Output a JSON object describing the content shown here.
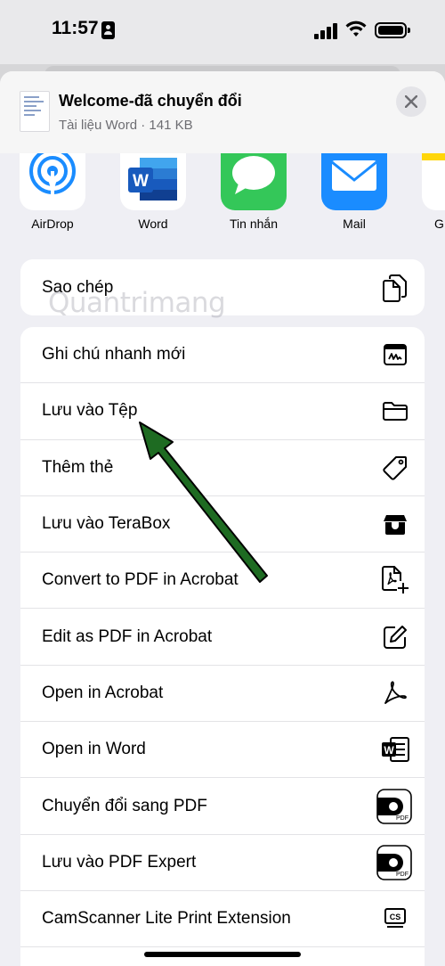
{
  "status": {
    "time": "11:57"
  },
  "header": {
    "title": "Welcome-đã chuyển đổi",
    "subtitle": "Tài liệu Word · 141 KB"
  },
  "apps": [
    {
      "label": "AirDrop",
      "icon": "airdrop-icon"
    },
    {
      "label": "Word",
      "icon": "word-icon"
    },
    {
      "label": "Tin nhắn",
      "icon": "messages-icon"
    },
    {
      "label": "Mail",
      "icon": "mail-icon"
    },
    {
      "label": "G",
      "icon": "notes-icon"
    }
  ],
  "copy_action": {
    "label": "Sao chép",
    "icon": "copy-icon"
  },
  "actions": [
    {
      "label": "Ghi chú nhanh mới",
      "icon": "quick-note-icon"
    },
    {
      "label": "Lưu vào Tệp",
      "icon": "folder-icon"
    },
    {
      "label": "Thêm thẻ",
      "icon": "tag-icon"
    },
    {
      "label": "Lưu vào TeraBox",
      "icon": "terabox-icon"
    },
    {
      "label": "Convert to PDF in Acrobat",
      "icon": "pdf-plus-icon"
    },
    {
      "label": "Edit as PDF in Acrobat",
      "icon": "edit-icon"
    },
    {
      "label": "Open in Acrobat",
      "icon": "acrobat-icon"
    },
    {
      "label": "Open in Word",
      "icon": "word-doc-icon"
    },
    {
      "label": "Chuyển đổi sang PDF",
      "icon": "pdf-expert-icon"
    },
    {
      "label": "Lưu vào PDF Expert",
      "icon": "pdf-expert-icon"
    },
    {
      "label": "CamScanner Lite Print Extension",
      "icon": "camscanner-icon"
    }
  ],
  "watermark": "Quantrimang",
  "colors": {
    "accent_arrow": "#1e6b22",
    "airdrop": "#1a8cff",
    "word": "#2b579a",
    "messages": "#34c759",
    "mail": "#1a8cff"
  }
}
